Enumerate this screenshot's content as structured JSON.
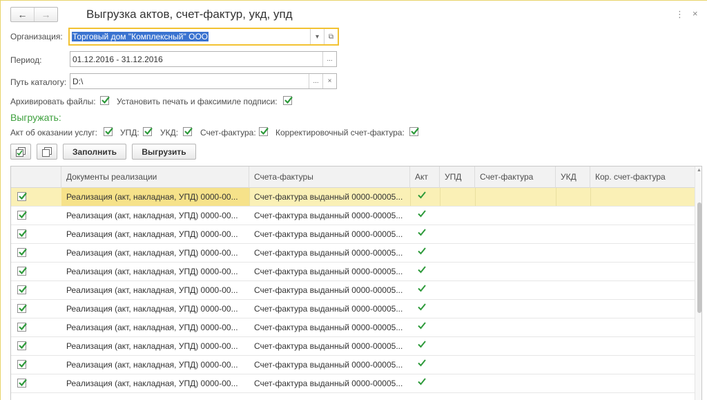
{
  "header": {
    "title": "Выгрузка актов, счет-фактур, укд, упд",
    "back_icon": "←",
    "forward_icon": "→",
    "more_icon": "⋮",
    "close_icon": "×"
  },
  "form": {
    "org_label": "Организация:",
    "org_value": "Торговый дом \"Комплексный\" ООО",
    "period_label": "Период:",
    "period_value": "01.12.2016 - 31.12.2016",
    "path_label": "Путь каталогу:",
    "path_value": "D:\\",
    "archive_label": "Архивировать файлы:",
    "archive_checked": true,
    "stamp_label": "Установить печать и факсимиле подписи:",
    "stamp_checked": true,
    "dropdown_icon": "▾",
    "open_icon": "⧉",
    "ellipsis": "...",
    "clear_icon": "×"
  },
  "export": {
    "section_title": "Выгружать:",
    "act_label": "Акт об оказании услуг:",
    "upd_label": "УПД:",
    "ukd_label": "УКД:",
    "invoice_label": "Счет-фактура:",
    "corr_invoice_label": "Корректировочный счет-фактура:"
  },
  "toolbar": {
    "fill_label": "Заполнить",
    "export_label": "Выгрузить"
  },
  "table": {
    "columns": [
      "Документы реализации",
      "Счета-фактуры",
      "Акт",
      "УПД",
      "Счет-фактура",
      "УКД",
      "Кор. счет-фактура"
    ],
    "rows": [
      {
        "doc": "Реализация (акт, накладная, УПД) 0000-00...",
        "invoice": "Счет-фактура выданный 0000-00005...",
        "act": true
      },
      {
        "doc": "Реализация (акт, накладная, УПД) 0000-00...",
        "invoice": "Счет-фактура выданный 0000-00005...",
        "act": true
      },
      {
        "doc": "Реализация (акт, накладная, УПД) 0000-00...",
        "invoice": "Счет-фактура выданный 0000-00005...",
        "act": true
      },
      {
        "doc": "Реализация (акт, накладная, УПД) 0000-00...",
        "invoice": "Счет-фактура выданный 0000-00005...",
        "act": true
      },
      {
        "doc": "Реализация (акт, накладная, УПД) 0000-00...",
        "invoice": "Счет-фактура выданный 0000-00005...",
        "act": true
      },
      {
        "doc": "Реализация (акт, накладная, УПД) 0000-00...",
        "invoice": "Счет-фактура выданный 0000-00005...",
        "act": true
      },
      {
        "doc": "Реализация (акт, накладная, УПД) 0000-00...",
        "invoice": "Счет-фактура выданный 0000-00005...",
        "act": true
      },
      {
        "doc": "Реализация (акт, накладная, УПД) 0000-00...",
        "invoice": "Счет-фактура выданный 0000-00005...",
        "act": true
      },
      {
        "doc": "Реализация (акт, накладная, УПД) 0000-00...",
        "invoice": "Счет-фактура выданный 0000-00005...",
        "act": true
      },
      {
        "doc": "Реализация (акт, накладная, УПД) 0000-00...",
        "invoice": "Счет-фактура выданный 0000-00005...",
        "act": true
      },
      {
        "doc": "Реализация (акт, накладная, УПД) 0000-00...",
        "invoice": "Счет-фактура выданный 0000-00005...",
        "act": true
      }
    ]
  },
  "colors": {
    "check_green": "#2d9a3a",
    "section_green": "#3ea03e",
    "focus_yellow": "#f2c232",
    "selected_row": "#faf0b6"
  }
}
